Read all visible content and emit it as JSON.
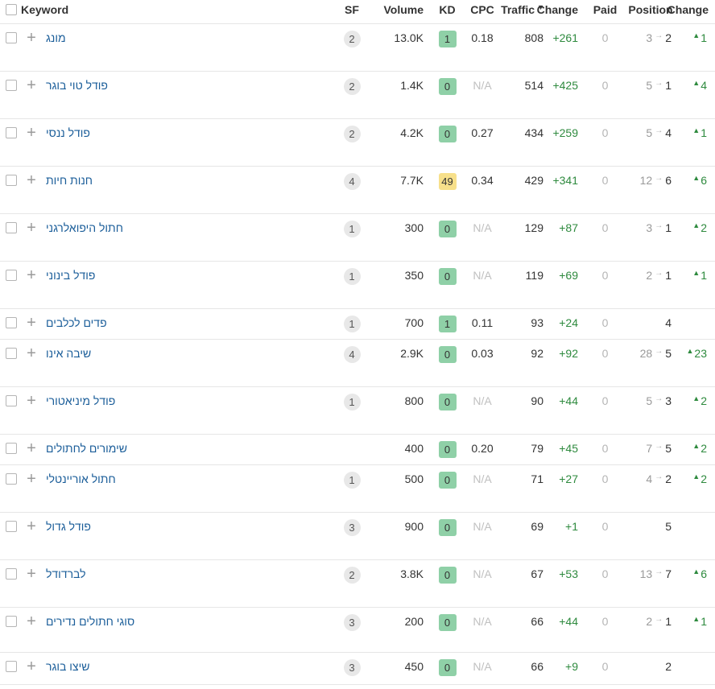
{
  "header": {
    "keyword": "Keyword",
    "sf": "SF",
    "volume": "Volume",
    "kd": "KD",
    "cpc": "CPC",
    "traffic": "Traffic",
    "traffic_sort_icon": "caret-down",
    "traffic_change": "Change",
    "paid": "Paid",
    "position": "Position",
    "position_change": "Change"
  },
  "colors": {
    "kd_easy": "#8fd0a7",
    "kd_medium": "#f7e08b",
    "link": "#1a5d99",
    "positive": "#2e8a3e"
  },
  "rows": [
    {
      "keyword": "מונג",
      "sf": "2",
      "volume": "13.0K",
      "kd": "1",
      "kd_level": "easy",
      "cpc": "0.18",
      "traffic": "808",
      "traffic_change": "+261",
      "paid": "0",
      "pos_prev": "3",
      "pos": "2",
      "pos_change": "1",
      "height": 59
    },
    {
      "keyword": "פודל טוי בוגר",
      "sf": "2",
      "volume": "1.4K",
      "kd": "0",
      "kd_level": "easy",
      "cpc": "N/A",
      "traffic": "514",
      "traffic_change": "+425",
      "paid": "0",
      "pos_prev": "5",
      "pos": "1",
      "pos_change": "4",
      "height": 59
    },
    {
      "keyword": "פודל ננסי",
      "sf": "2",
      "volume": "4.2K",
      "kd": "0",
      "kd_level": "easy",
      "cpc": "0.27",
      "traffic": "434",
      "traffic_change": "+259",
      "paid": "0",
      "pos_prev": "5",
      "pos": "4",
      "pos_change": "1",
      "height": 59
    },
    {
      "keyword": "חנות חיות",
      "sf": "4",
      "volume": "7.7K",
      "kd": "49",
      "kd_level": "medium",
      "cpc": "0.34",
      "traffic": "429",
      "traffic_change": "+341",
      "paid": "0",
      "pos_prev": "12",
      "pos": "6",
      "pos_change": "6",
      "height": 59
    },
    {
      "keyword": "חתול היפואלרגני",
      "sf": "1",
      "volume": "300",
      "kd": "0",
      "kd_level": "easy",
      "cpc": "N/A",
      "traffic": "129",
      "traffic_change": "+87",
      "paid": "0",
      "pos_prev": "3",
      "pos": "1",
      "pos_change": "2",
      "height": 59
    },
    {
      "keyword": "פודל בינוני",
      "sf": "1",
      "volume": "350",
      "kd": "0",
      "kd_level": "easy",
      "cpc": "N/A",
      "traffic": "119",
      "traffic_change": "+69",
      "paid": "0",
      "pos_prev": "2",
      "pos": "1",
      "pos_change": "1",
      "height": 59
    },
    {
      "keyword": "פדים לכלבים",
      "sf": "1",
      "volume": "700",
      "kd": "1",
      "kd_level": "easy",
      "cpc": "0.11",
      "traffic": "93",
      "traffic_change": "+24",
      "paid": "0",
      "pos_prev": "",
      "pos": "4",
      "pos_change": "",
      "height": 38
    },
    {
      "keyword": "שיבה אינו",
      "sf": "4",
      "volume": "2.9K",
      "kd": "0",
      "kd_level": "easy",
      "cpc": "0.03",
      "traffic": "92",
      "traffic_change": "+92",
      "paid": "0",
      "pos_prev": "28",
      "pos": "5",
      "pos_change": "23",
      "height": 59
    },
    {
      "keyword": "פודל מיניאטורי",
      "sf": "1",
      "volume": "800",
      "kd": "0",
      "kd_level": "easy",
      "cpc": "N/A",
      "traffic": "90",
      "traffic_change": "+44",
      "paid": "0",
      "pos_prev": "5",
      "pos": "3",
      "pos_change": "2",
      "height": 59
    },
    {
      "keyword": "שימורים לחתולים",
      "sf": "",
      "volume": "400",
      "kd": "0",
      "kd_level": "easy",
      "cpc": "0.20",
      "traffic": "79",
      "traffic_change": "+45",
      "paid": "0",
      "pos_prev": "7",
      "pos": "5",
      "pos_change": "2",
      "height": 38
    },
    {
      "keyword": "חתול אוריינטלי",
      "sf": "1",
      "volume": "500",
      "kd": "0",
      "kd_level": "easy",
      "cpc": "N/A",
      "traffic": "71",
      "traffic_change": "+27",
      "paid": "0",
      "pos_prev": "4",
      "pos": "2",
      "pos_change": "2",
      "height": 59
    },
    {
      "keyword": "פודל גדול",
      "sf": "3",
      "volume": "900",
      "kd": "0",
      "kd_level": "easy",
      "cpc": "N/A",
      "traffic": "69",
      "traffic_change": "+1",
      "paid": "0",
      "pos_prev": "",
      "pos": "5",
      "pos_change": "",
      "height": 59
    },
    {
      "keyword": "לברדודל",
      "sf": "2",
      "volume": "3.8K",
      "kd": "0",
      "kd_level": "easy",
      "cpc": "N/A",
      "traffic": "67",
      "traffic_change": "+53",
      "paid": "0",
      "pos_prev": "13",
      "pos": "7",
      "pos_change": "6",
      "height": 59
    },
    {
      "keyword": "סוגי חתולים נדירים",
      "sf": "3",
      "volume": "200",
      "kd": "0",
      "kd_level": "easy",
      "cpc": "N/A",
      "traffic": "66",
      "traffic_change": "+44",
      "paid": "0",
      "pos_prev": "2",
      "pos": "1",
      "pos_change": "1",
      "height": 56
    },
    {
      "keyword": "שיצו בוגר",
      "sf": "3",
      "volume": "450",
      "kd": "0",
      "kd_level": "easy",
      "cpc": "N/A",
      "traffic": "66",
      "traffic_change": "+9",
      "paid": "0",
      "pos_prev": "",
      "pos": "2",
      "pos_change": "",
      "height": 40
    }
  ]
}
